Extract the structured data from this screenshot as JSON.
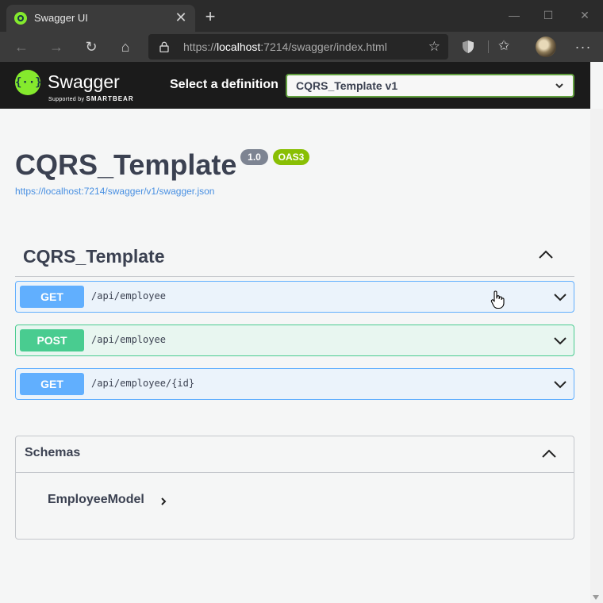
{
  "browser": {
    "tab_title": "Swagger UI",
    "tab_close": "✕",
    "new_tab": "+",
    "window_minimize": "—",
    "window_maximize": "☐",
    "window_close": "✕",
    "url_prefix": "https://",
    "url_host": "localhost",
    "url_rest": ":7214/swagger/index.html",
    "back": "←",
    "forward": "→",
    "refresh": "↻",
    "home": "⌂",
    "more": "···"
  },
  "topbar": {
    "logo_name": "Swagger",
    "logo_sub_prefix": "Supported by ",
    "logo_sub_brand": "SMARTBEAR",
    "definition_label": "Select a definition",
    "definition_selected": "CQRS_Template v1"
  },
  "info": {
    "title": "CQRS_Template",
    "version": "1.0",
    "oas": "OAS3",
    "spec_url": "https://localhost:7214/swagger/v1/swagger.json"
  },
  "tag": {
    "name": "CQRS_Template"
  },
  "operations": [
    {
      "method": "GET",
      "path": "/api/employee"
    },
    {
      "method": "POST",
      "path": "/api/employee"
    },
    {
      "method": "GET",
      "path": "/api/employee/{id}"
    }
  ],
  "schemas": {
    "title": "Schemas",
    "models": [
      {
        "name": "EmployeeModel"
      }
    ]
  },
  "colors": {
    "get": "#61affe",
    "post": "#49cc90",
    "swagger_green": "#85ea2d",
    "topbar_bg": "#1b1b1b",
    "text": "#3b4151"
  }
}
